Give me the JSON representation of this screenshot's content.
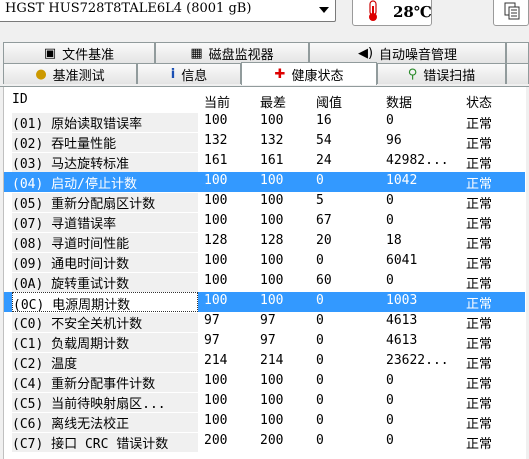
{
  "toolbar": {
    "drive": "HGST HUS728T8TALE6L4 (8001 gB)",
    "temperature": "28℃",
    "thermometer_icon": "thermometer-icon",
    "copy_icon": "copy-icon"
  },
  "tabs": {
    "row1": [
      {
        "label": "文件基准",
        "icon": "file-benchmark-icon"
      },
      {
        "label": "磁盘监视器",
        "icon": "disk-monitor-icon"
      },
      {
        "label": "自动噪音管理",
        "icon": "speaker-icon"
      }
    ],
    "row2": [
      {
        "label": "基准测试",
        "icon": "lightbulb-icon"
      },
      {
        "label": "信息",
        "icon": "info-icon"
      },
      {
        "label": "健康状态",
        "icon": "health-cross-icon"
      },
      {
        "label": "错误扫描",
        "icon": "magnifier-icon"
      }
    ],
    "active": "健康状态"
  },
  "table": {
    "columns": [
      "ID",
      "当前",
      "最差",
      "阈值",
      "数据",
      "状态"
    ],
    "rows": [
      [
        "(01) 原始读取错误率",
        "100",
        "100",
        "16",
        "0",
        "正常"
      ],
      [
        "(02) 吞吐量性能",
        "132",
        "132",
        "54",
        "96",
        "正常"
      ],
      [
        "(03) 马达旋转标准",
        "161",
        "161",
        "24",
        "42982...",
        "正常"
      ],
      [
        "(04) 启动/停止计数",
        "100",
        "100",
        "0",
        "1042",
        "正常"
      ],
      [
        "(05) 重新分配扇区计数",
        "100",
        "100",
        "5",
        "0",
        "正常"
      ],
      [
        "(07) 寻道错误率",
        "100",
        "100",
        "67",
        "0",
        "正常"
      ],
      [
        "(08) 寻道时间性能",
        "128",
        "128",
        "20",
        "18",
        "正常"
      ],
      [
        "(09) 通电时间计数",
        "100",
        "100",
        "0",
        "6041",
        "正常"
      ],
      [
        "(0A) 旋转重试计数",
        "100",
        "100",
        "60",
        "0",
        "正常"
      ],
      [
        "(0C) 电源周期计数",
        "100",
        "100",
        "0",
        "1003",
        "正常"
      ],
      [
        "(C0) 不安全关机计数",
        "97",
        "97",
        "0",
        "4613",
        "正常"
      ],
      [
        "(C1) 负载周期计数",
        "97",
        "97",
        "0",
        "4613",
        "正常"
      ],
      [
        "(C2) 温度",
        "214",
        "214",
        "0",
        "23622...",
        "正常"
      ],
      [
        "(C4) 重新分配事件计数",
        "100",
        "100",
        "0",
        "0",
        "正常"
      ],
      [
        "(C5) 当前待映射扇区...",
        "100",
        "100",
        "0",
        "0",
        "正常"
      ],
      [
        "(C6) 离线无法校正",
        "100",
        "100",
        "0",
        "0",
        "正常"
      ],
      [
        "(C7) 接口 CRC 错误计数",
        "200",
        "200",
        "0",
        "0",
        "正常"
      ]
    ],
    "selected_rows": [
      3,
      9
    ]
  },
  "colors": {
    "selection": "#3399ff",
    "id_column_bg": "#f0f0f0"
  }
}
